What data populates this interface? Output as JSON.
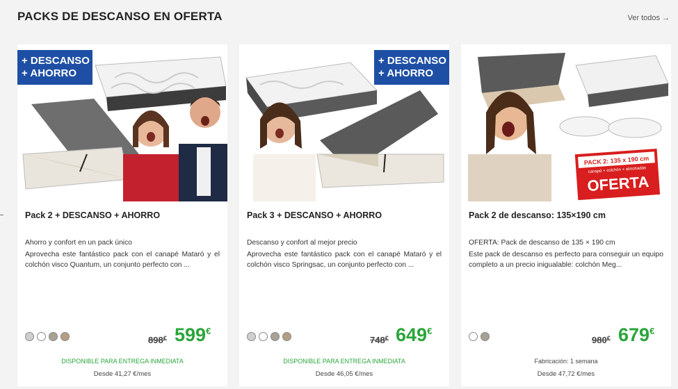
{
  "section": {
    "title": "PACKS DE DESCANSO EN OFERTA",
    "see_all": "Ver todos",
    "see_all_arrow": "→"
  },
  "products": [
    {
      "badge": "+ DESCANSO\n+ AHORRO",
      "name": "Pack 2 + DESCANSO + AHORRO",
      "subtitle": "Ahorro y confort en un pack único",
      "description": "Aprovecha este fantástico pack con el canapé Mataró y el colchón visco Quantum, un conjunto perfecto con ...",
      "swatches": [
        "#cfcfcf",
        "#ffffff",
        "#a8a295",
        "#b49f82"
      ],
      "old_price": "898",
      "new_price": "599",
      "currency": "€",
      "availability": "DISPONIBLE PARA ENTREGA INMEDIATA",
      "monthly": "Desde 41,27 €/mes"
    },
    {
      "badge": "+ DESCANSO\n+ AHORRO",
      "name": "Pack 3 + DESCANSO + AHORRO",
      "subtitle": "Descanso y confort al mejor precio",
      "description": "Aprovecha este fantástico pack con el canapé Mataró y el colchón visco Springsac, un conjunto perfecto con ...",
      "swatches": [
        "#cfcfcf",
        "#ffffff",
        "#a8a295",
        "#b49f82"
      ],
      "old_price": "748",
      "new_price": "649",
      "currency": "€",
      "availability": "DISPONIBLE PARA ENTREGA INMEDIATA",
      "monthly": "Desde 46,05 €/mes"
    },
    {
      "name": "Pack 2 de descanso: 135×190 cm",
      "subtitle": "OFERTA: Pack de descanso de 135 × 190 cm",
      "description": "Este pack de descanso es perfecto para conseguir un equipo completo a un precio inigualable: colchón Meg...",
      "swatches": [
        "#ffffff",
        "#a8a295"
      ],
      "old_price": "980",
      "new_price": "679",
      "currency": "€",
      "availability": "Fabricación: 1 semana",
      "monthly": "Desde 47,72 €/mes",
      "promo_label_1": "PACK 2: 135 x 190 cm",
      "promo_label_2": "canapé + colchón + almohadas",
      "promo_label_3": "OFERTA"
    }
  ]
}
